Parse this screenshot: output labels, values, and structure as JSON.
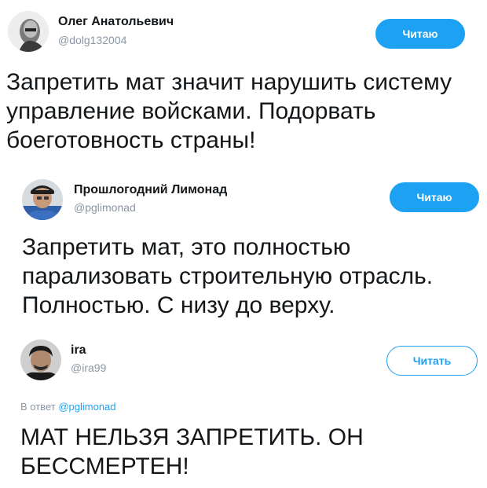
{
  "tweets": [
    {
      "name": "Олег Анатольевич",
      "handle": "@dolg132004",
      "button": "Читаю",
      "text": "Запретить мат значит нарушить систему управление войсками. Подорвать боеготовность страны!"
    },
    {
      "name": "Прошлогодний Лимонад",
      "handle": "@pglimonad",
      "button": "Читаю",
      "text": "Запретить мат, это полностью парализовать строительную отрасль. Полностью. С низу до верху."
    },
    {
      "name": "ira",
      "handle": "@ira99",
      "button": "Читать",
      "reply_prefix": "В ответ",
      "reply_to": "@pglimonad",
      "text": "МАТ НЕЛЬЗЯ ЗАПРЕТИТЬ. ОН БЕССМЕРТЕН!"
    }
  ],
  "colors": {
    "accent": "#1da1f2",
    "muted": "#8a96a3"
  }
}
